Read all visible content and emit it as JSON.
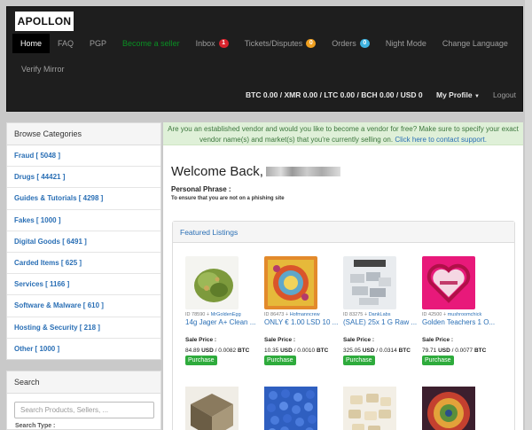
{
  "logo": "APOLLON",
  "nav": {
    "home": "Home",
    "faq": "FAQ",
    "pgp": "PGP",
    "become_seller": "Become a seller",
    "inbox": "Inbox",
    "inbox_count": "1",
    "tickets": "Tickets/Disputes",
    "tickets_count": "0",
    "orders": "Orders",
    "orders_count": "0",
    "night_mode": "Night Mode",
    "change_language": "Change Language",
    "verify_mirror": "Verify Mirror",
    "balances": "BTC 0.00 / XMR 0.00 / LTC 0.00 / BCH 0.00 / USD 0",
    "my_profile": "My Profile",
    "logout": "Logout"
  },
  "colors": {
    "inbox_badge": "#d9232d",
    "tickets_badge": "#f0a020",
    "orders_badge": "#3fb3e0"
  },
  "sidebar": {
    "heading": "Browse Categories",
    "categories": [
      "Fraud [ 5048 ]",
      "Drugs [ 44421 ]",
      "Guides & Tutorials [ 4298 ]",
      "Fakes [ 1000 ]",
      "Digital Goods [ 6491 ]",
      "Carded Items [ 625 ]",
      "Services [ 1166 ]",
      "Software & Malware [ 610 ]",
      "Hosting & Security [ 218 ]",
      "Other [ 1000 ]"
    ]
  },
  "search": {
    "heading": "Search",
    "placeholder": "Search Products, Sellers, ...",
    "cut_label": "Search Type :"
  },
  "alert": {
    "text": "Are you an established vendor and would you like to become a vendor for free? Make sure to specify your exact vendor name(s) and market(s) that you're currently selling on.",
    "link": "Click here to contact support."
  },
  "welcome": {
    "greeting": "Welcome Back,",
    "phrase_label": "Personal Phrase :",
    "phrase_hint": "To ensure that you are not on a phishing site"
  },
  "featured": {
    "heading": "Featured Listings",
    "listings": [
      {
        "id_text": "ID 78590 ⍭",
        "vendor": "MrGoldenEgg",
        "title": "14g Jager A+ Clean ...",
        "sale_label": "Sale Price :",
        "usd": "84.89",
        "btc": "0.0082",
        "buy": "Purchase"
      },
      {
        "id_text": "ID 86473 ⍭",
        "vendor": "Hofmanncrew",
        "title": "ONLY € 1.00 LSD 10 ...",
        "sale_label": "Sale Price :",
        "usd": "10.35",
        "btc": "0.0010",
        "buy": "Purchase"
      },
      {
        "id_text": "ID 83275 ⍭",
        "vendor": "DankLabs",
        "title": "(SALE) 25x 1 G Raw ...",
        "sale_label": "Sale Price :",
        "usd": "325.05",
        "btc": "0.0314",
        "buy": "Purchase"
      },
      {
        "id_text": "ID 42500 ⍭",
        "vendor": "mushroomchick",
        "title": "Golden Teachers 1 O...",
        "sale_label": "Sale Price :",
        "usd": "79.71",
        "btc": "0.0077",
        "buy": "Purchase"
      }
    ],
    "usd_unit": "USD",
    "btc_unit": "BTC"
  }
}
